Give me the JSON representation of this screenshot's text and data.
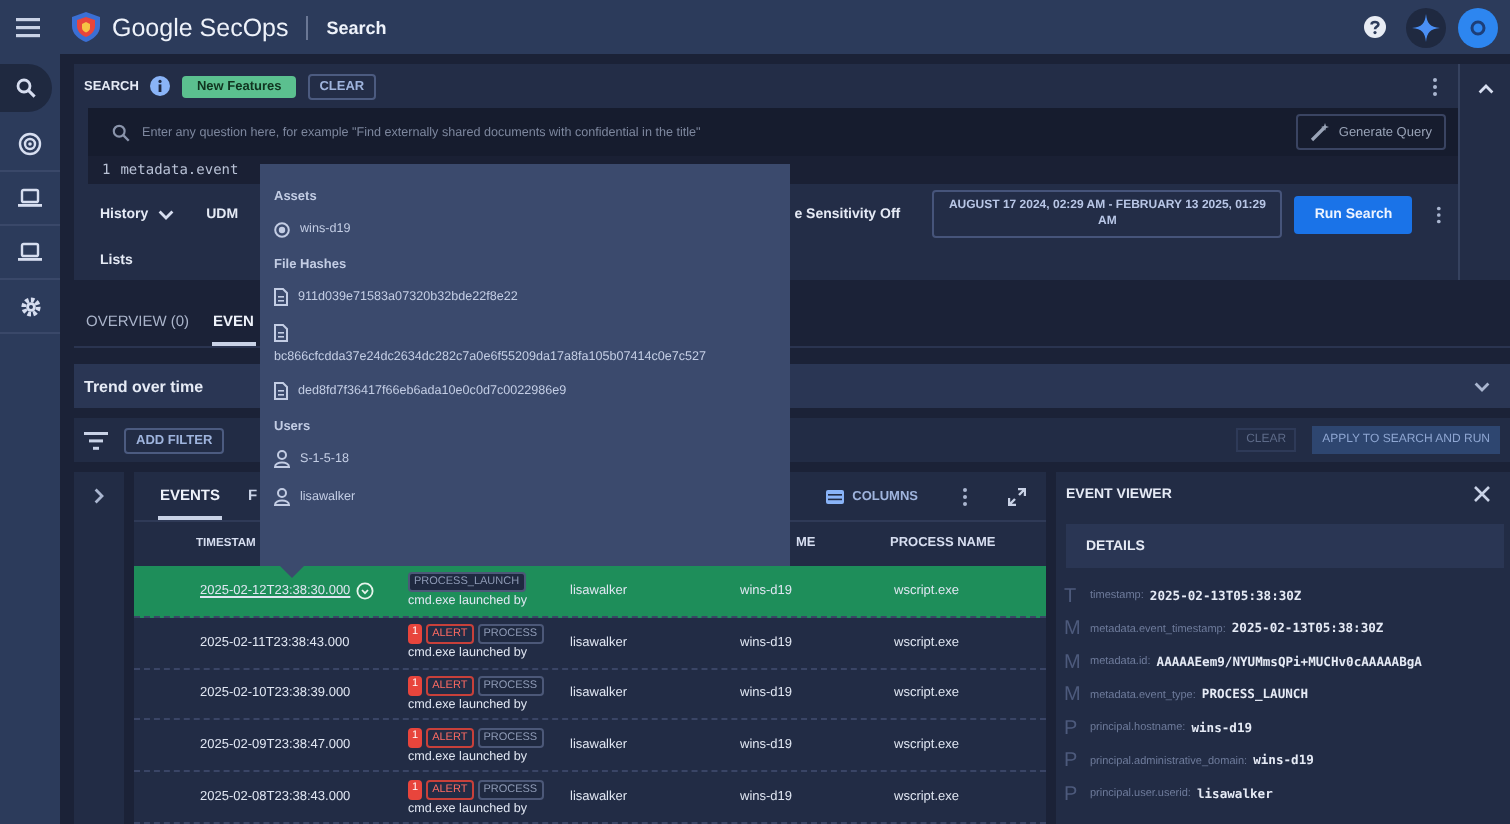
{
  "top_bar": {
    "product": "Google SecOps",
    "page": "Search"
  },
  "nav": [
    {
      "kind": "search",
      "selected": true
    },
    {
      "kind": "radar",
      "selected": false
    },
    {
      "kind": "laptop",
      "selected": false
    },
    {
      "kind": "laptop",
      "selected": false
    },
    {
      "kind": "gear",
      "selected": false
    }
  ],
  "search": {
    "label": "SEARCH",
    "badge": "New Features",
    "clear": "CLEAR",
    "placeholder": "Enter any question here, for example \"Find externally shared documents with confidential in the title\"",
    "generate_button": "Generate Query",
    "line_number": "1",
    "query": "metadata.event",
    "history": "History",
    "udm": "UDM",
    "case_sensitivity": "e Sensitivity Off",
    "date_range": "AUGUST 17 2024, 02:29 AM - FEBRUARY 13 2025, 01:29 AM",
    "run_button": "Run Search",
    "lists": "Lists"
  },
  "tabs": [
    {
      "label": "OVERVIEW (0)",
      "selected": false
    },
    {
      "label": "EVEN",
      "selected": true
    }
  ],
  "trend": {
    "title": "Trend over time"
  },
  "filters": {
    "add": "ADD FILTER",
    "clear": "CLEAR",
    "apply": "APPLY TO SEARCH AND RUN"
  },
  "events": {
    "tabs": [
      {
        "label": "EVENTS",
        "selected": true
      },
      {
        "label": "F",
        "selected": false
      }
    ],
    "columns_button": "COLUMNS",
    "columns": [
      "TIMESTAM",
      "",
      "",
      "ME",
      "PROCESS NAME"
    ],
    "rows": [
      {
        "selected": true,
        "timestamp": "2025-02-12T23:38:30.000",
        "badges": [
          {
            "kind": "type",
            "text": "PROCESS_LAUNCH"
          }
        ],
        "summary": "cmd.exe launched by",
        "user": "lisawalker",
        "host": "wins-d19",
        "process": "wscript.exe"
      },
      {
        "selected": false,
        "timestamp": "2025-02-11T23:38:43.000",
        "badges": [
          {
            "kind": "count",
            "text": "1"
          },
          {
            "kind": "alert",
            "text": "ALERT"
          },
          {
            "kind": "type",
            "text": "PROCESS"
          }
        ],
        "summary": "cmd.exe launched by",
        "user": "lisawalker",
        "host": "wins-d19",
        "process": "wscript.exe"
      },
      {
        "selected": false,
        "timestamp": "2025-02-10T23:38:39.000",
        "badges": [
          {
            "kind": "count",
            "text": "1"
          },
          {
            "kind": "alert",
            "text": "ALERT"
          },
          {
            "kind": "type",
            "text": "PROCESS"
          }
        ],
        "summary": "cmd.exe launched by",
        "user": "lisawalker",
        "host": "wins-d19",
        "process": "wscript.exe"
      },
      {
        "selected": false,
        "timestamp": "2025-02-09T23:38:47.000",
        "badges": [
          {
            "kind": "count",
            "text": "1"
          },
          {
            "kind": "alert",
            "text": "ALERT"
          },
          {
            "kind": "type",
            "text": "PROCESS"
          }
        ],
        "summary": "cmd.exe launched by",
        "user": "lisawalker",
        "host": "wins-d19",
        "process": "wscript.exe"
      },
      {
        "selected": false,
        "timestamp": "2025-02-08T23:38:43.000",
        "badges": [
          {
            "kind": "count",
            "text": "1"
          },
          {
            "kind": "alert",
            "text": "ALERT"
          },
          {
            "kind": "type",
            "text": "PROCESS"
          }
        ],
        "summary": "cmd.exe launched by",
        "user": "lisawalker",
        "host": "wins-d19",
        "process": "wscript.exe"
      }
    ]
  },
  "event_viewer": {
    "title": "EVENT VIEWER",
    "section": "DETAILS",
    "fields": [
      {
        "type": "T",
        "key": "timestamp:",
        "value": "2025-02-13T05:38:30Z"
      },
      {
        "type": "M",
        "key": "metadata.event_timestamp:",
        "value": "2025-02-13T05:38:30Z"
      },
      {
        "type": "M",
        "key": "metadata.id:",
        "value": "AAAAAEem9/NYUMmsQPi+MUCHv0cAAAAABgA"
      },
      {
        "type": "M",
        "key": "metadata.event_type:",
        "value": "PROCESS_LAUNCH"
      },
      {
        "type": "P",
        "key": "principal.hostname:",
        "value": "wins-d19"
      },
      {
        "type": "P",
        "key": "principal.administrative_domain:",
        "value": "wins-d19"
      },
      {
        "type": "P",
        "key": "principal.user.userid:",
        "value": "lisawalker"
      }
    ]
  },
  "popup": {
    "sections": [
      {
        "title": "Assets",
        "items": [
          {
            "kind": "asset",
            "text": "wins-d19"
          }
        ]
      },
      {
        "title": "File Hashes",
        "items": [
          {
            "kind": "hash",
            "text": "911d039e71583a07320b32bde22f8e22"
          },
          {
            "kind": "hash_wrapped",
            "text": "bc866cfcdda37e24dc2634dc282c7a0e6f55209da17a8fa105b07414c0e7c527"
          },
          {
            "kind": "hash",
            "text": "ded8fd7f36417f66eb6ada10e0c0d7c0022986e9"
          }
        ]
      },
      {
        "title": "Users",
        "items": [
          {
            "kind": "user",
            "text": "S-1-5-18"
          },
          {
            "kind": "user",
            "text": "lisawalker"
          }
        ]
      }
    ]
  }
}
